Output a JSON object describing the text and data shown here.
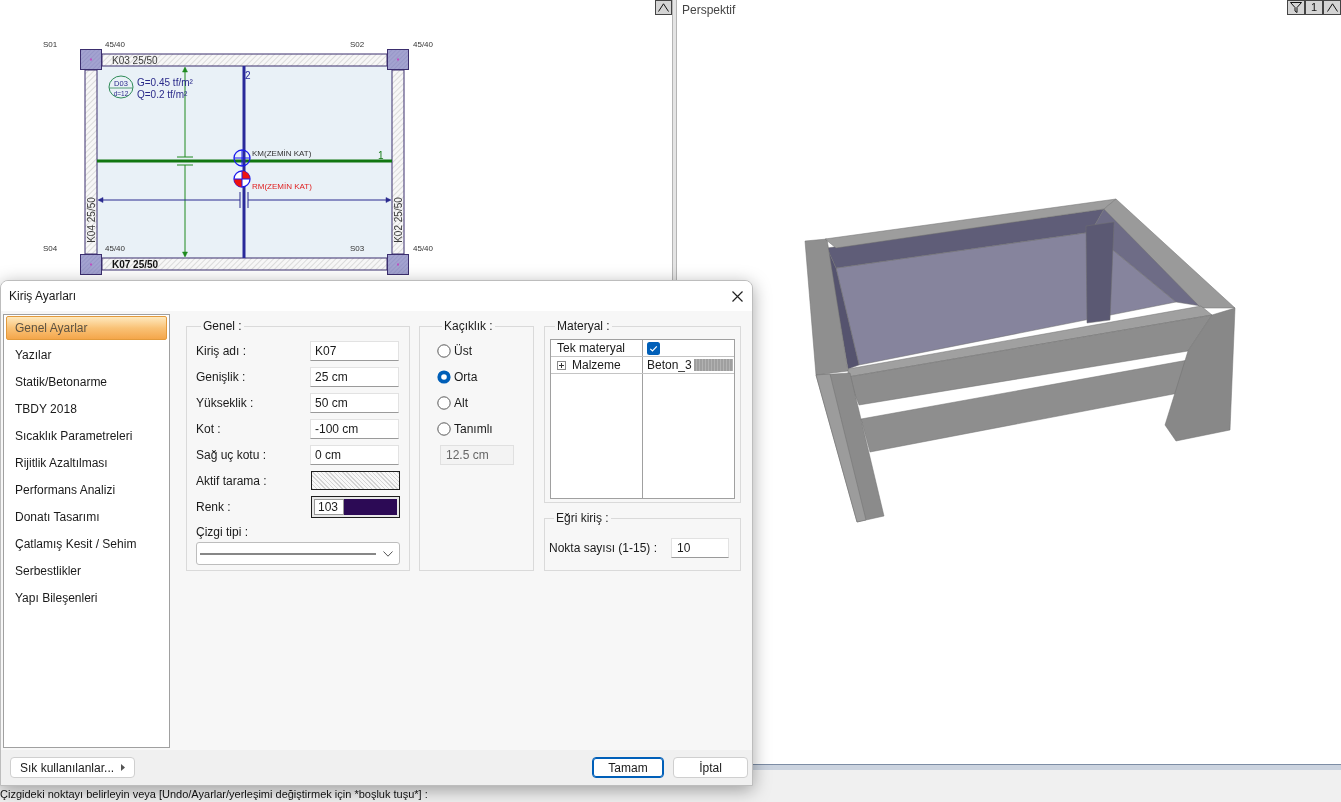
{
  "plan": {
    "columns": [
      {
        "name": "S01",
        "size": "45/40"
      },
      {
        "name": "S02",
        "size": "45/40"
      },
      {
        "name": "S04",
        "size": "45/40"
      },
      {
        "name": "S03",
        "size": "45/40"
      }
    ],
    "beams": [
      {
        "label": "K03 25/50",
        "selected": false
      },
      {
        "label": "K04 25/50",
        "selected": false
      },
      {
        "label": "K02 25/50",
        "selected": false
      },
      {
        "label": "K07 25/50",
        "selected": true
      }
    ],
    "slab": {
      "id": "D03",
      "thickness": "d=12",
      "loads": [
        "G=0.45 tf/m²",
        "Q=0.2 tf/m²"
      ]
    },
    "axes": [
      "1",
      "2"
    ],
    "markers": [
      {
        "kind": "km",
        "label": "KM(ZEMİN KAT)"
      },
      {
        "kind": "rm",
        "label": "RM(ZEMİN KAT)"
      }
    ]
  },
  "perspective": {
    "title": "Perspektif",
    "view_number": "1"
  },
  "dialog": {
    "title": "Kiriş Ayarları",
    "sidebar": [
      {
        "label": "Genel Ayarlar",
        "selected": true
      },
      {
        "label": "Yazılar",
        "selected": false
      },
      {
        "label": "Statik/Betonarme",
        "selected": false
      },
      {
        "label": "TBDY 2018",
        "selected": false
      },
      {
        "label": "Sıcaklık Parametreleri",
        "selected": false
      },
      {
        "label": "Rijitlik Azaltılması",
        "selected": false
      },
      {
        "label": "Performans Analizi",
        "selected": false
      },
      {
        "label": "Donatı Tasarımı",
        "selected": false
      },
      {
        "label": "Çatlamış Kesit / Sehim",
        "selected": false
      },
      {
        "label": "Serbestlikler",
        "selected": false
      },
      {
        "label": "Yapı Bileşenleri",
        "selected": false
      }
    ],
    "general": {
      "title": "Genel :",
      "fields": [
        {
          "kind": "text",
          "label": "Kiriş adı :",
          "value": "K07"
        },
        {
          "kind": "text",
          "label": "Genişlik :",
          "value": "25 cm"
        },
        {
          "kind": "text",
          "label": "Yükseklik :",
          "value": "50 cm"
        },
        {
          "kind": "text",
          "label": "Kot :",
          "value": "-100 cm"
        },
        {
          "kind": "text",
          "label": "Sağ uç kotu :",
          "value": "0 cm"
        },
        {
          "kind": "hatch",
          "label": "Aktif tarama :"
        },
        {
          "kind": "color",
          "label": "Renk :",
          "value": "103",
          "color": "#2c0a55"
        }
      ],
      "line_type": {
        "label": "Çizgi tipi :"
      }
    },
    "offset": {
      "title": "Kaçıklık :",
      "options": [
        {
          "label": "Üst",
          "selected": false
        },
        {
          "label": "Orta",
          "selected": true
        },
        {
          "label": "Alt",
          "selected": false
        },
        {
          "label": "Tanımlı",
          "selected": false
        }
      ],
      "input": {
        "value": "12.5 cm",
        "disabled": true
      }
    },
    "material": {
      "title": "Materyal :",
      "rows": [
        {
          "kind": "checkbox",
          "label": "Tek materyal",
          "checked": true
        },
        {
          "kind": "expandable",
          "label": "Malzeme",
          "value": "Beton_3",
          "expanded": false
        }
      ]
    },
    "curved": {
      "title": "Eğri kiriş :",
      "label": "Nokta sayısı (1-15) :",
      "value": "10"
    },
    "footer": {
      "favorites": "Sık kullanılanlar...",
      "buttons": [
        {
          "label": "Tamam",
          "default": true
        },
        {
          "label": "İptal",
          "default": false
        }
      ]
    }
  },
  "command_line": "Çizgideki noktayı belirleyin veya [Undo/Ayarlar/yerleşimi değiştirmek için *boşluk tuşu*] :"
}
